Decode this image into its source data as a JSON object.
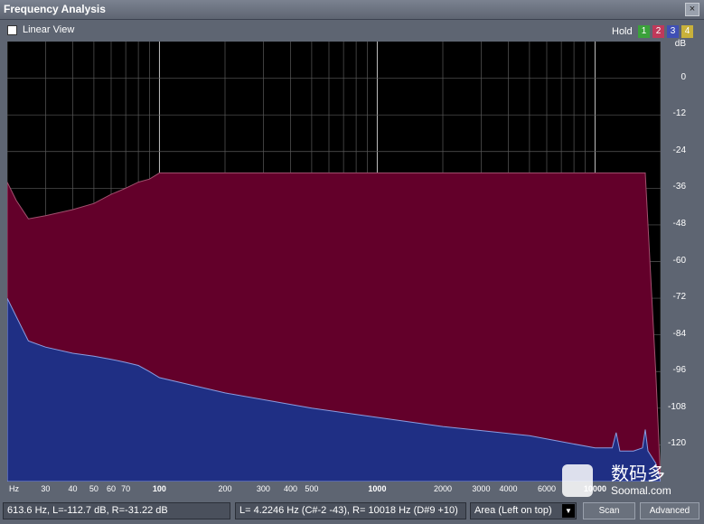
{
  "window": {
    "title": "Frequency Analysis",
    "close_glyph": "×"
  },
  "toolbar": {
    "linear_view_label": "Linear View",
    "hold_label": "Hold",
    "hold_buttons": [
      {
        "label": "1",
        "color": "#3aa13a"
      },
      {
        "label": "2",
        "color": "#c0395a"
      },
      {
        "label": "3",
        "color": "#3f4fb5"
      },
      {
        "label": "4",
        "color": "#c9b13a"
      }
    ]
  },
  "chart_data": {
    "type": "area",
    "xscale": "log",
    "xlim": [
      20,
      20000
    ],
    "ylim": [
      -132,
      12
    ],
    "y_unit": "dB",
    "x_unit": "Hz",
    "yticks": [
      "dB",
      "0",
      "-12",
      "-24",
      "-36",
      "-48",
      "-60",
      "-72",
      "-84",
      "-96",
      "-108",
      "-120"
    ],
    "xticks": [
      "30",
      "40",
      "50",
      "60",
      "70",
      "100",
      "200",
      "300",
      "400",
      "500",
      "1000",
      "2000",
      "3000",
      "4000",
      "6000",
      "10000"
    ],
    "series": [
      {
        "color": "#63002a",
        "x": [
          20,
          22,
          25,
          30,
          40,
          50,
          60,
          70,
          80,
          90,
          100,
          200,
          500,
          1000,
          2000,
          5000,
          10000,
          15000,
          17000,
          19000,
          20000
        ],
        "y": [
          -34,
          -40,
          -46,
          -45,
          -43,
          -41,
          -38,
          -36,
          -34,
          -33,
          -31,
          -31,
          -31,
          -31,
          -31,
          -31,
          -31,
          -31,
          -31,
          -96,
          -132
        ]
      },
      {
        "color": "#1f2f84",
        "x": [
          20,
          22,
          25,
          30,
          40,
          50,
          60,
          70,
          80,
          90,
          100,
          200,
          500,
          1000,
          2000,
          5000,
          10000,
          12000,
          12500,
          13000,
          15000,
          16500,
          17000,
          17500,
          19000,
          20000
        ],
        "y": [
          -72,
          -78,
          -86,
          -88,
          -90,
          -91,
          -92,
          -93,
          -94,
          -96,
          -98,
          -103,
          -108,
          -111,
          -114,
          -117,
          -121,
          -121,
          -116,
          -122,
          -122,
          -121,
          -115,
          -122,
          -126,
          -132
        ]
      }
    ]
  },
  "axes": {
    "x_unit_label": "Hz"
  },
  "status": {
    "cursor_readout": "613.6 Hz, L=-112.7 dB, R=-31.22 dB",
    "peak_readout": "L= 4.2246 Hz (C#-2 -43), R=  10018 Hz (D#9 +10)",
    "display_mode": "Area (Left on top)",
    "scan_label": "Scan",
    "advanced_label": "Advanced"
  },
  "watermark": {
    "cn": "数码多",
    "en": "Soomal.com"
  }
}
